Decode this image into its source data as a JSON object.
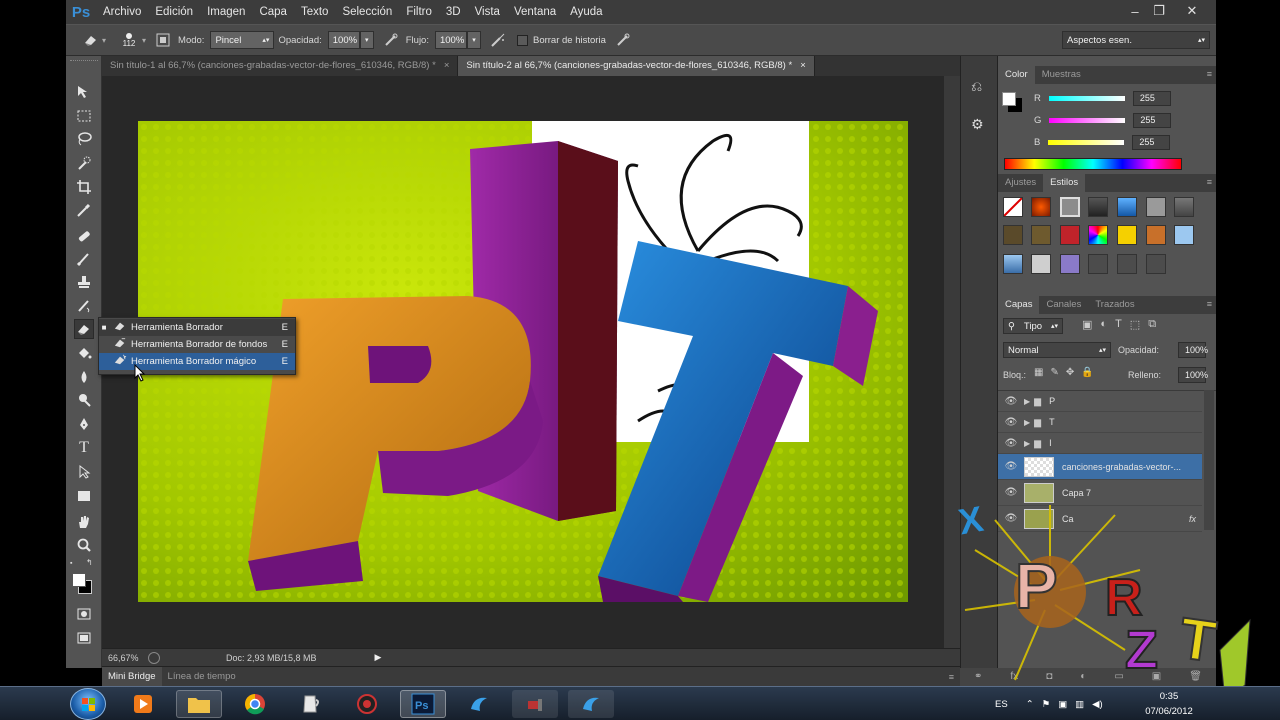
{
  "app": {
    "logo": "Ps",
    "menu": [
      "Archivo",
      "Edición",
      "Imagen",
      "Capa",
      "Texto",
      "Selección",
      "Filtro",
      "3D",
      "Vista",
      "Ventana",
      "Ayuda"
    ],
    "window_controls": [
      "–",
      "❐",
      "✕"
    ]
  },
  "options": {
    "brush_size": "112",
    "mode_label": "Modo:",
    "mode_value": "Pincel",
    "opacity_label": "Opacidad:",
    "opacity_value": "100%",
    "flow_label": "Flujo:",
    "flow_value": "100%",
    "history_label": "Borrar de historia",
    "workspace": "Aspectos esen."
  },
  "tabs": [
    {
      "label": "Sin título-1 al 66,7% (canciones-grabadas-vector-de-flores_610346, RGB/8) *",
      "close": "×",
      "active": false
    },
    {
      "label": "Sin título-2 al 66,7% (canciones-grabadas-vector-de-flores_610346, RGB/8) *",
      "close": "×",
      "active": true
    }
  ],
  "flyout": {
    "items": [
      {
        "label": "Herramienta Borrador",
        "key": "E",
        "selected": true
      },
      {
        "label": "Herramienta Borrador de fondos",
        "key": "E",
        "selected": false
      },
      {
        "label": "Herramienta Borrador mágico",
        "key": "E",
        "selected": false
      }
    ],
    "selected_mark": "■"
  },
  "status": {
    "zoom": "66,67%",
    "doc": "Doc: 2,93 MB/15,8 MB"
  },
  "bridge": {
    "tabs": [
      "Mini Bridge",
      "Línea de tiempo"
    ]
  },
  "color_panel": {
    "tabs": [
      "Color",
      "Muestras"
    ],
    "channels": [
      {
        "name": "R",
        "value": "255"
      },
      {
        "name": "G",
        "value": "255"
      },
      {
        "name": "B",
        "value": "255"
      }
    ]
  },
  "styles_panel": {
    "tabs": [
      "Ajustes",
      "Estilos"
    ]
  },
  "layers_panel": {
    "tabs": [
      "Capas",
      "Canales",
      "Trazados"
    ],
    "filter": "Tipo",
    "blend_mode": "Normal",
    "opacity_label": "Opacidad:",
    "opacity_value": "100%",
    "lock_label": "Bloq.:",
    "fill_label": "Relleno:",
    "fill_value": "100%",
    "layers": [
      {
        "name": "P",
        "type": "group"
      },
      {
        "name": "T",
        "type": "group"
      },
      {
        "name": "I",
        "type": "group"
      },
      {
        "name": "canciones-grabadas-vector-...",
        "type": "image",
        "selected": true
      },
      {
        "name": "Capa 7",
        "type": "image"
      },
      {
        "name": "Ca",
        "type": "image",
        "fx": "fx"
      }
    ]
  },
  "taskbar": {
    "language": "ES",
    "time": "0:35",
    "date": "07/06/2012"
  },
  "colors": {
    "canvas_bg": "#282828",
    "panel_bg": "#535353",
    "lime": "#a6cc00",
    "accent_blue": "#1a6fb8",
    "purple": "#8a1f8e",
    "orange": "#e38a1f"
  }
}
